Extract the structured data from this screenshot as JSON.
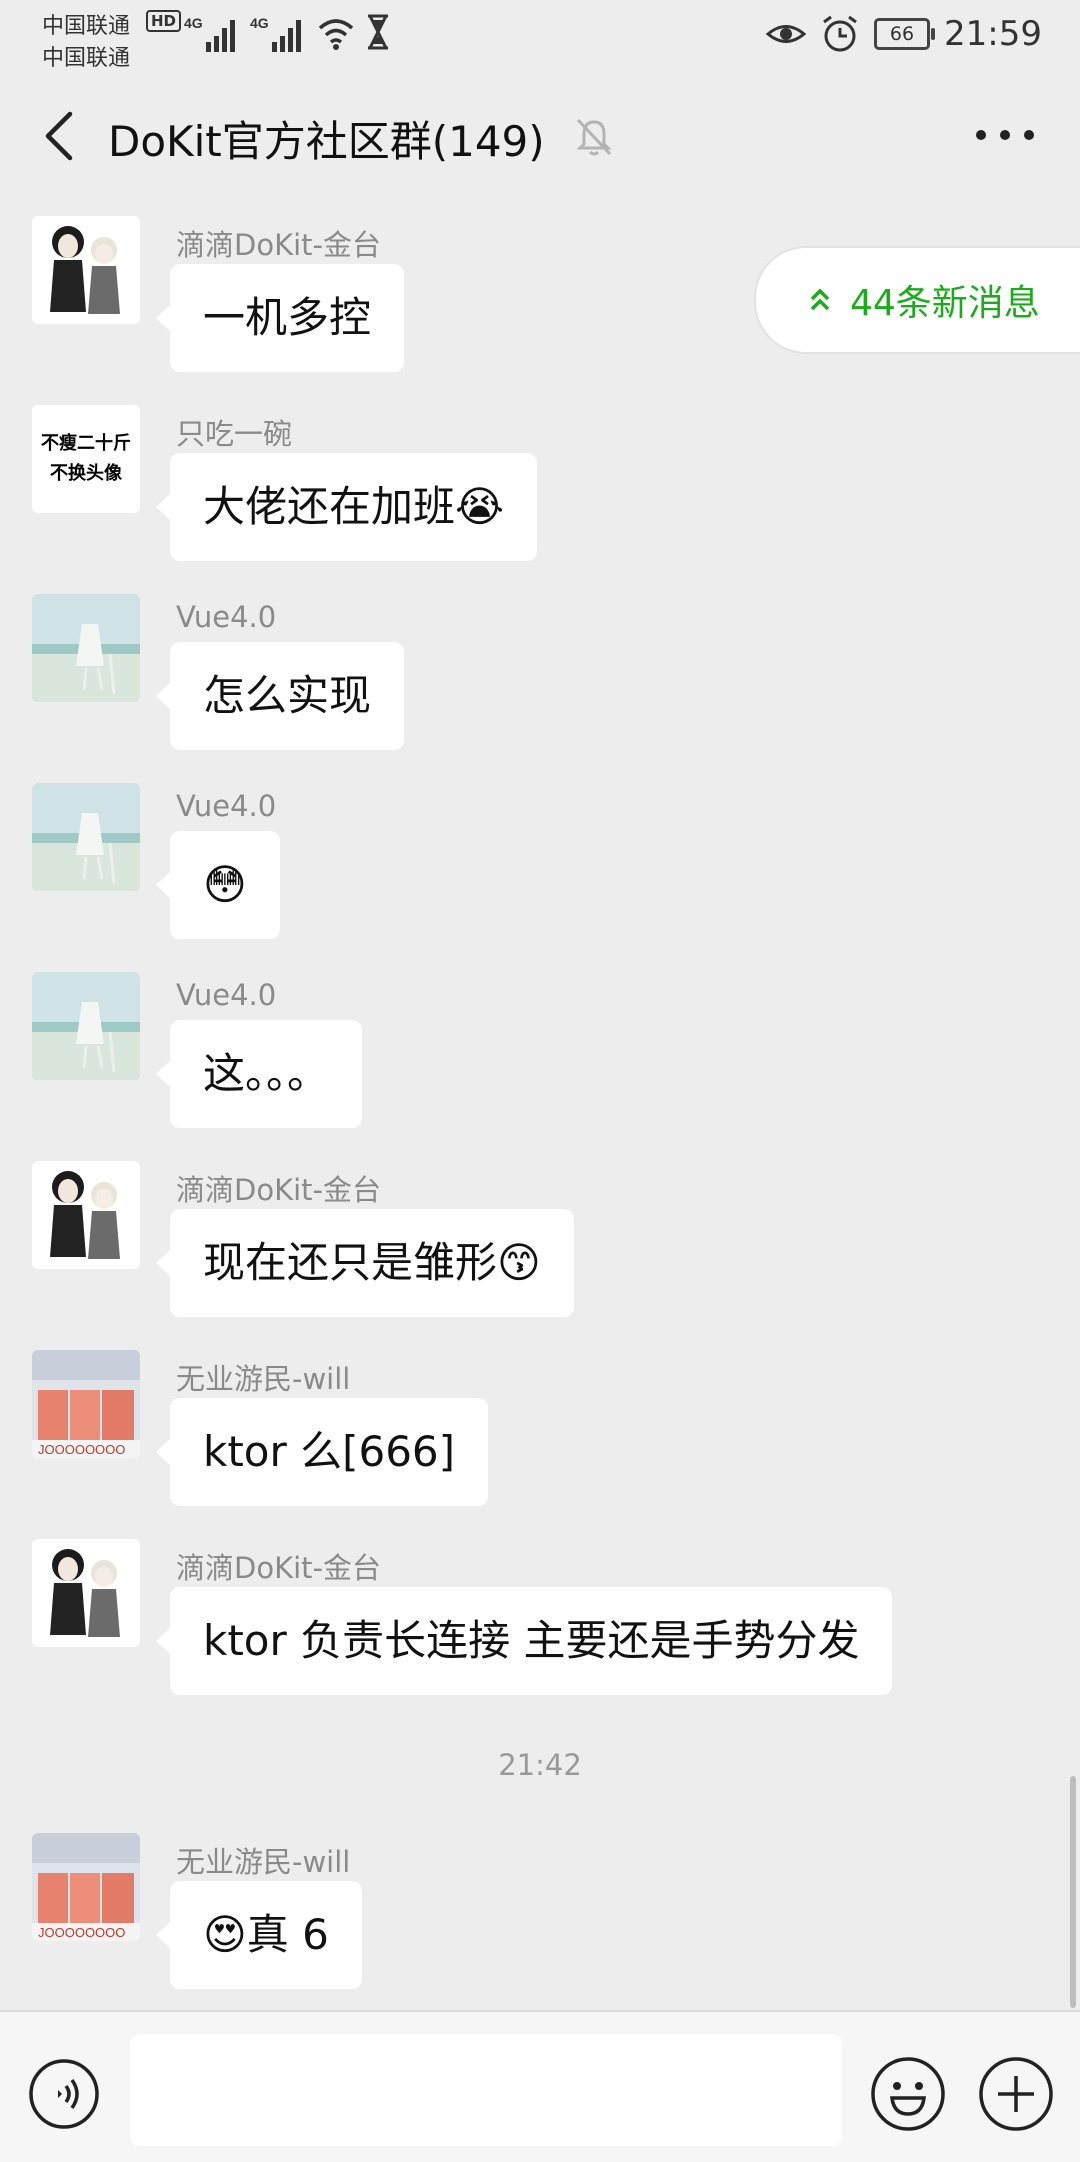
{
  "status_bar": {
    "carrier1": "中国联通",
    "carrier2": "中国联通",
    "hd": "HD",
    "network1": "4G",
    "network2": "4G",
    "battery": "66",
    "time": "21:59"
  },
  "header": {
    "title": "DoKit官方社区群(149)"
  },
  "new_messages": {
    "label": "44条新消息"
  },
  "messages": [
    {
      "sender": "滴滴DoKit-金台",
      "text": "一机多控",
      "avatar": "sherlock-avatar"
    },
    {
      "sender": "只吃一碗",
      "text": "大佬还在加班😭",
      "avatar": "text-avatar",
      "avatar_text": [
        "不瘦二十斤",
        "不换头像"
      ]
    },
    {
      "sender": "Vue4.0",
      "text": "怎么实现",
      "avatar": "beach-avatar"
    },
    {
      "sender": "Vue4.0",
      "text": "😳",
      "avatar": "beach-avatar"
    },
    {
      "sender": "Vue4.0",
      "text": "这。。。",
      "avatar": "beach-avatar"
    },
    {
      "sender": "滴滴DoKit-金台",
      "text": "现在还只是雏形😙",
      "avatar": "sherlock-avatar"
    },
    {
      "sender": "无业游民-will",
      "text": "ktor 么[666]",
      "avatar": "money-avatar"
    },
    {
      "sender": "滴滴DoKit-金台",
      "text": "ktor 负责长连接 主要还是手势分发",
      "avatar": "sherlock-avatar"
    },
    {
      "sender": "无业游民-will",
      "text": "😍真 6",
      "avatar": "money-avatar"
    }
  ],
  "timestamp": "21:42",
  "colors": {
    "background": "#ededed",
    "bubble": "#ffffff",
    "accent_green": "#1aad19",
    "sender_gray": "#8a8a8a"
  }
}
